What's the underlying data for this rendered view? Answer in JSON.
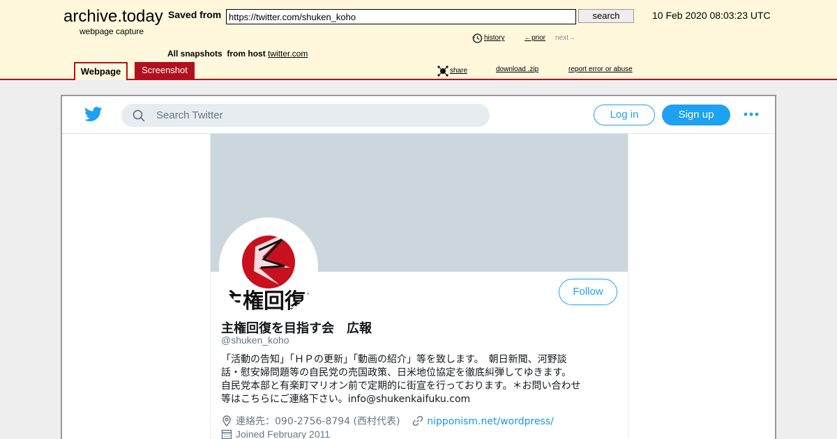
{
  "archive": {
    "logo": "archive.today",
    "subtitle": "webpage capture",
    "saved_from_label": "Saved from",
    "url_value": "https://twitter.com/shuken_koho",
    "search_button": "search",
    "capture_date": "10 Feb 2020 08:03:23 UTC",
    "history_link": "history",
    "prior_link": "←prior",
    "next_link": "next→",
    "snapshots_label": "All snapshots",
    "from_host_label": "from host",
    "host_link": "twitter.com",
    "share_link": "share",
    "download_link": "download .zip",
    "report_link": "report error or abuse",
    "tabs": [
      {
        "label": "Webpage",
        "active": true
      },
      {
        "label": "Screenshot",
        "active": false
      }
    ],
    "colors": {
      "header_bg": "#fff8dc",
      "accent": "#b2101e"
    }
  },
  "twitter": {
    "search_placeholder": "Search Twitter",
    "login_button": "Log in",
    "signup_button": "Sign up",
    "follow_button": "Follow",
    "colors": {
      "brand": "#1da1f2",
      "banner": "#ccd6dd"
    },
    "profile": {
      "name": "主権回復を目指す会　広報",
      "handle": "@shuken_koho",
      "bio_lines": [
        "「活動の告知」「ＨＰの更新」「動画の紹介」等を致します。　朝日新聞、河野談",
        "話・慰安婦問題等の自民党の売国政策、日米地位協定を徹底糾弾してゆきます。",
        "自民党本部と有楽町マリオン前で定期的に街宣を行っております。＊お問い合わせ",
        "等はこちらにご連絡下さい。info@shukenkaifuku.com"
      ],
      "location": "連絡先：090-2756-8794 (西村代表)",
      "website": "nipponism.net/wordpress/",
      "joined": "Joined February 2011",
      "avatar_text": "主権回復を"
    }
  }
}
